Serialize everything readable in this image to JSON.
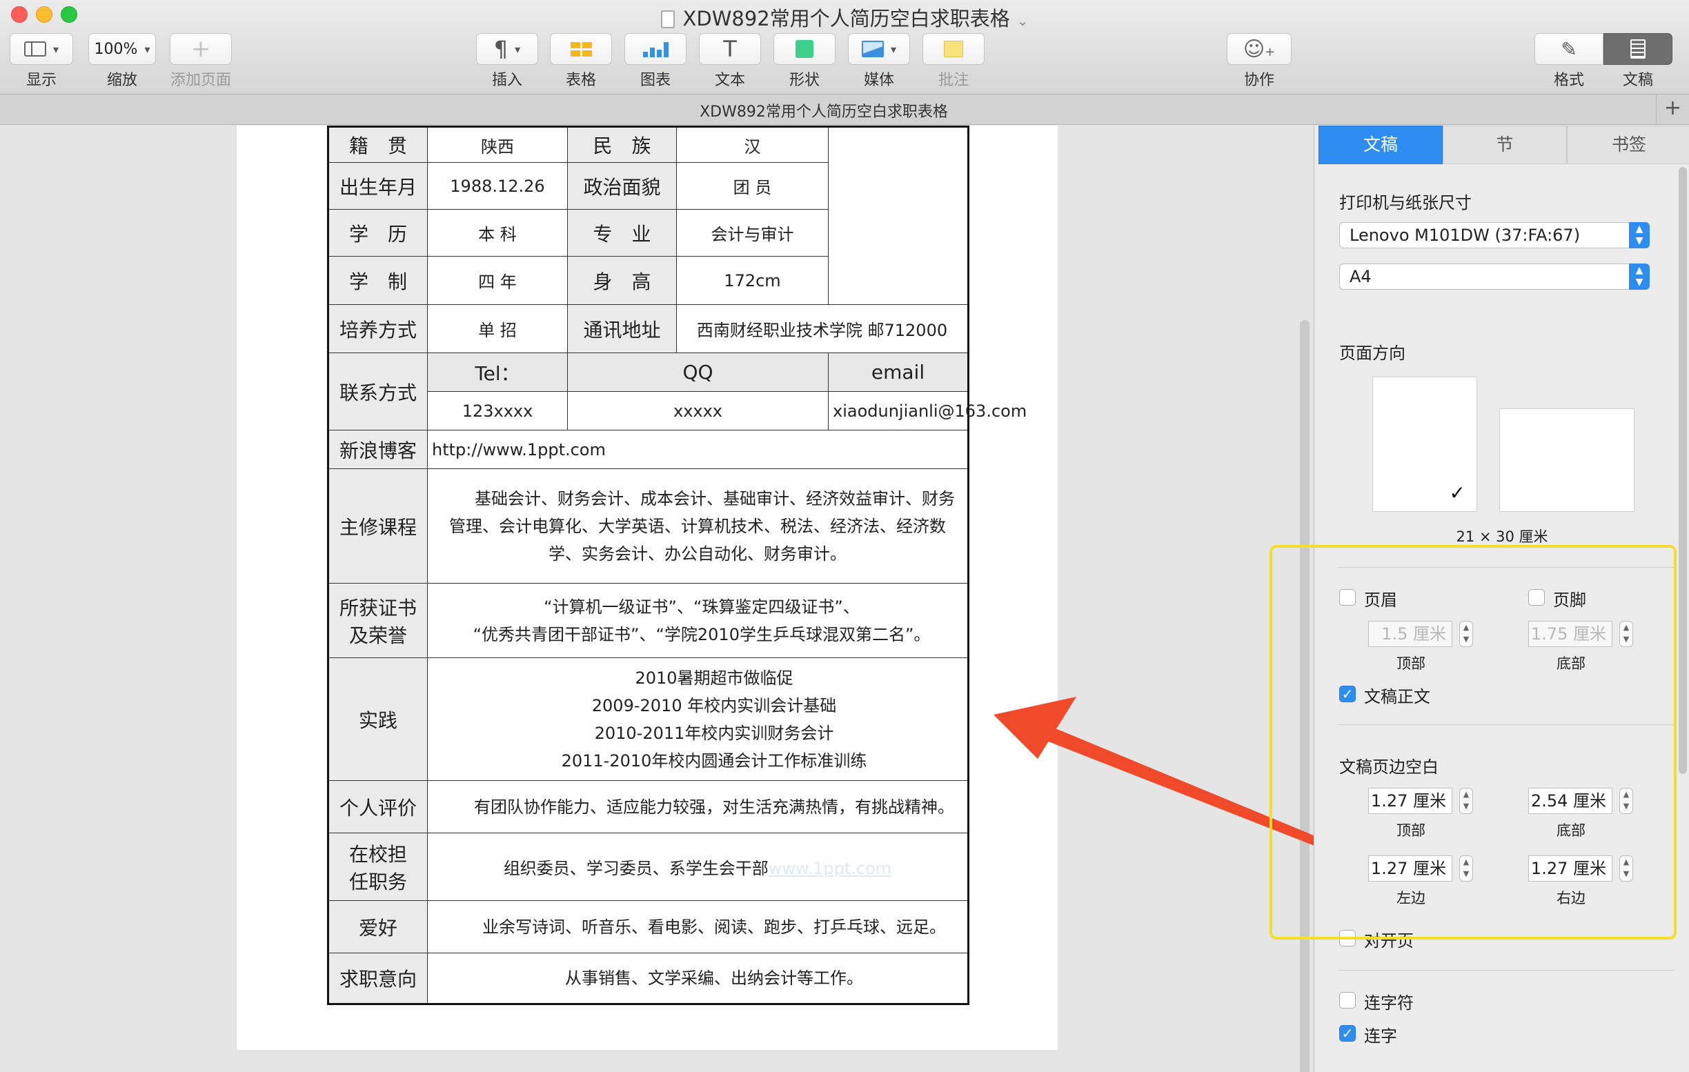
{
  "window": {
    "title": "XDW892常用个人简历空白求职表格",
    "tab_title": "XDW892常用个人简历空白求职表格"
  },
  "toolbar": {
    "view": "显示",
    "zoom_value": "100%",
    "zoom": "缩放",
    "add_page": "添加页面",
    "insert": "插入",
    "table": "表格",
    "chart": "图表",
    "text": "文本",
    "shape": "形状",
    "media": "媒体",
    "comment": "批注",
    "collaborate": "协作",
    "format": "格式",
    "document": "文稿"
  },
  "resume": {
    "r1": {
      "l1": "籍　贯",
      "v1": "陕西",
      "l2": "民　族",
      "v2": "汉"
    },
    "r2": {
      "l1": "出生年月",
      "v1": "1988.12.26",
      "l2": "政治面貌",
      "v2": "团 员"
    },
    "r3": {
      "l1": "学　历",
      "v1": "本 科",
      "l2": "专　业",
      "v2": "会计与审计"
    },
    "r4": {
      "l1": "学　制",
      "v1": "四 年",
      "l2": "身　高",
      "v2": "172cm"
    },
    "r5": {
      "l1": "培养方式",
      "v1": "单 招",
      "l2": "通讯地址",
      "v2": "西南财经职业技术学院  邮712000"
    },
    "contact": {
      "label": "联系方式",
      "h1": "Tel：",
      "h2": "QQ",
      "h3": "email",
      "v1": "123xxxx",
      "v2": "xxxxx",
      "v3": "xiaodunjianli@163.com"
    },
    "blog": {
      "label": "新浪博客",
      "value": "http://www.1ppt.com"
    },
    "courses": {
      "label": "主修课程",
      "value": "基础会计、财务会计、成本会计、基础审计、经济效益审计、财务管理、会计电算化、大学英语、计算机技术、税法、经济法、经济数学、实务会计、办公自动化、财务审计。"
    },
    "certs": {
      "label1": "所获证书",
      "label2": "及荣誉",
      "line1": "“计算机一级证书”、“珠算鉴定四级证书”、",
      "line2": "“优秀共青团干部证书”、“学院2010学生乒乓球混双第二名”。"
    },
    "practice": {
      "label": "实践",
      "lines": [
        "2010暑期超市做临促",
        "2009-2010 年校内实训会计基础",
        "2010-2011年校内实训财务会计",
        "2011-2010年校内圆通会计工作标准训练"
      ]
    },
    "self_eval": {
      "label": "个人评价",
      "value": "有团队协作能力、适应能力较强，对生活充满热情，有挑战精神。"
    },
    "positions": {
      "label1": "在校担",
      "label2": "任职务",
      "value": "组织委员、学习委员、系学生会干部",
      "watermark": "www.1ppt.com"
    },
    "hobbies": {
      "label": "爱好",
      "value": "业余写诗词、听音乐、看电影、阅读、跑步、打乒乓球、远足。"
    },
    "intent": {
      "label": "求职意向",
      "value": "从事销售、文学采编、出纳会计等工作。"
    }
  },
  "inspector": {
    "tabs": [
      "文稿",
      "节",
      "书签"
    ],
    "printer_section": "打印机与纸张尺寸",
    "printer": "Lenovo M101DW (37:FA:67)",
    "paper": "A4",
    "orientation_section": "页面方向",
    "paper_size": "21 × 30 厘米",
    "header_label": "页眉",
    "footer_label": "页脚",
    "header_value": "1.5 厘米",
    "footer_value": "1.75 厘米",
    "top_label": "顶部",
    "bottom_label": "底部",
    "body_label": "文稿正文",
    "margins_section": "文稿页边空白",
    "margin_top": "1.27 厘米",
    "margin_bottom": "2.54 厘米",
    "margin_left": "1.27 厘米",
    "margin_right": "1.27 厘米",
    "left_label": "左边",
    "right_label": "右边",
    "facing_pages": "对开页",
    "hyphenation": "连字符",
    "ligatures": "连字"
  },
  "colors": {
    "accent": "#2f8cf1",
    "highlight": "#f5dd2a",
    "arrow": "#f04a2a"
  }
}
